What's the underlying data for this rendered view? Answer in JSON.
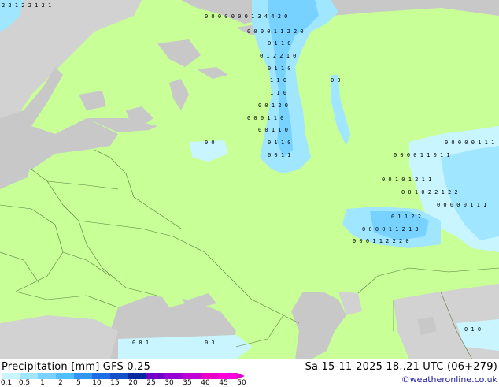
{
  "map": {
    "values_grid": [
      {
        "row": "north1",
        "text": "2 2 1 2 2 1 2 1"
      },
      {
        "row": "n2",
        "text": "0 0 0 0 0 0 0 1 3 4 4 2 0"
      },
      {
        "row": "n3",
        "text": "0 0 0 0 1 1 2 2 0"
      },
      {
        "row": "n4",
        "text": "0 1 1 0"
      },
      {
        "row": "n5",
        "text": "0 1 2 2 1 0"
      }
    ],
    "labels": {
      "a": "0 1 1 0",
      "b": "1 1 0",
      "c": "1 1 0",
      "d": "0 0 1 2 0",
      "e": "0 0 0 1 1 0",
      "f": "0 0 1 1 0",
      "g": "0 1 1 0",
      "h": "0 0 1 1",
      "i": "0 0",
      "j": "0 0 0 0 0 1 1 1",
      "k": "0 0 0 0 1 1 0 1 1",
      "l": "0 0 1 0 1 2 1 1",
      "m": "0 1 1 2 2",
      "n": "0 0 1 0 2 2 1 2 2",
      "o": "0 0 0 0 1 1 2 1 3",
      "p": "0 0 0 1 1 2 2 2 0",
      "q": "0 0 0 0 0 1 1 1",
      "r": "0 1 0",
      "s": "0 0 1",
      "t": "0 0",
      "u": "0 3"
    }
  },
  "footer": {
    "title": "Precipitation [mm]  GFS 0.25",
    "date": "Sa 15-11-2025 18..21 UTC (06+279)",
    "credit": "©weatheronline.co.uk",
    "scale_ticks": [
      "0.1",
      "0.5",
      "1",
      "2",
      "5",
      "10",
      "15",
      "20",
      "25",
      "30",
      "35",
      "40",
      "45",
      "50"
    ],
    "scale_colors": [
      "#c8f5ff",
      "#a0e6ff",
      "#78d2ff",
      "#50beff",
      "#3296f0",
      "#1e6ee6",
      "#1450c8",
      "#0a28a0",
      "#6e00c8",
      "#9600d2",
      "#be00d2",
      "#e600c8",
      "#ff00dc"
    ]
  }
}
